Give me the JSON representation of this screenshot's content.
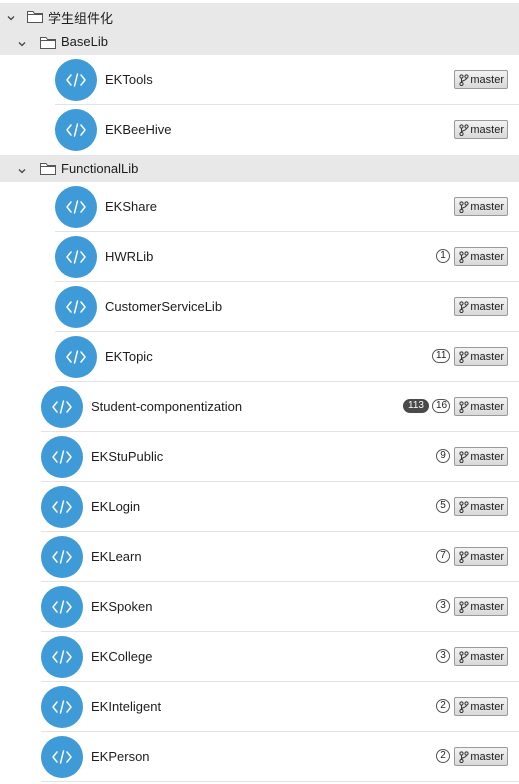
{
  "colors": {
    "avatar": "#3f9bd8",
    "group_bg": "#e8e8e8"
  },
  "groups": [
    {
      "name": "学生组件化",
      "icon": "chevron-down-icon"
    },
    {
      "name": "BaseLib",
      "icon": "chevron-down-icon"
    },
    {
      "name": "FunctionalLib",
      "icon": "chevron-down-icon"
    }
  ],
  "repos": [
    {
      "name": "EKTools",
      "branch": "master",
      "incoming": null,
      "outgoing": null
    },
    {
      "name": "EKBeeHive",
      "branch": "master",
      "incoming": null,
      "outgoing": null
    },
    {
      "name": "EKShare",
      "branch": "master",
      "incoming": null,
      "outgoing": null
    },
    {
      "name": "HWRLib",
      "branch": "master",
      "incoming": null,
      "outgoing": "1"
    },
    {
      "name": "CustomerServiceLib",
      "branch": "master",
      "incoming": null,
      "outgoing": null
    },
    {
      "name": "EKTopic",
      "branch": "master",
      "incoming": null,
      "outgoing": "11"
    },
    {
      "name": "Student-componentization",
      "branch": "master",
      "incoming": "113",
      "outgoing": "16"
    },
    {
      "name": "EKStuPublic",
      "branch": "master",
      "incoming": null,
      "outgoing": "9"
    },
    {
      "name": "EKLogin",
      "branch": "master",
      "incoming": null,
      "outgoing": "5"
    },
    {
      "name": "EKLearn",
      "branch": "master",
      "incoming": null,
      "outgoing": "7"
    },
    {
      "name": "EKSpoken",
      "branch": "master",
      "incoming": null,
      "outgoing": "3"
    },
    {
      "name": "EKCollege",
      "branch": "master",
      "incoming": null,
      "outgoing": "3"
    },
    {
      "name": "EKInteligent",
      "branch": "master",
      "incoming": null,
      "outgoing": "2"
    },
    {
      "name": "EKPerson",
      "branch": "master",
      "incoming": null,
      "outgoing": "2"
    }
  ]
}
